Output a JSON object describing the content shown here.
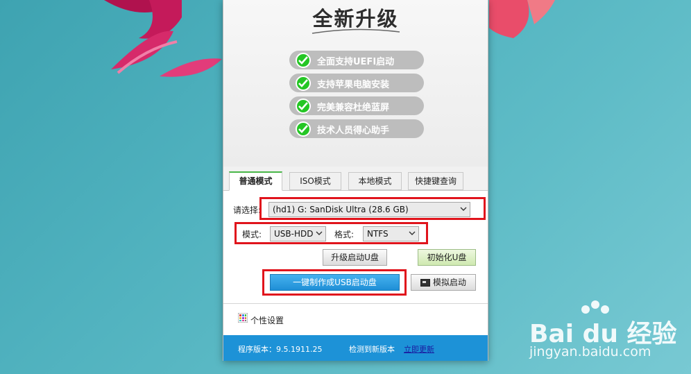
{
  "hero": {
    "title": "全新升级",
    "features": [
      "全面支持UEFI启动",
      "支持苹果电脑安装",
      "完美兼容杜绝蓝屏",
      "技术人员得心助手"
    ]
  },
  "tabs": [
    "普通模式",
    "ISO模式",
    "本地模式",
    "快捷键查询"
  ],
  "active_tab": "普通模式",
  "form": {
    "select_label": "请选择:",
    "device_value": "(hd1) G: SanDisk Ultra (28.6 GB)",
    "mode_label": "模式:",
    "mode_value": "USB-HDD",
    "format_label": "格式:",
    "format_value": "NTFS"
  },
  "buttons": {
    "upgrade": "升级启动U盘",
    "init": "初始化U盘",
    "make": "一键制作成USB启动盘",
    "simulate": "模拟启动"
  },
  "settings": {
    "label": "个性设置"
  },
  "status": {
    "version": "程序版本：9.5.1911.25",
    "new_version": "检测到新版本",
    "update_link": "立即更新"
  },
  "watermark": {
    "logo": "Bai du 经验",
    "site": "jingyan.baidu.com"
  },
  "colors": {
    "accent": "#1d92d7",
    "check": "#24c624",
    "highlight": "#e0141c",
    "tab_active": "#49b748"
  }
}
